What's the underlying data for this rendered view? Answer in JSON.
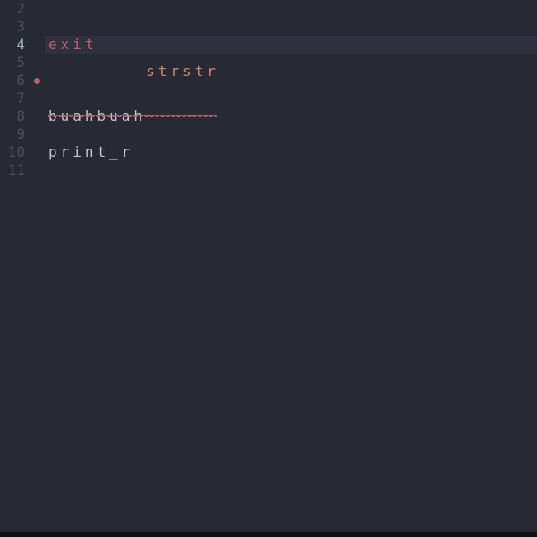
{
  "editor": {
    "current_line": 4,
    "lines": [
      {
        "number": 2,
        "text": "",
        "token": null,
        "marker": null
      },
      {
        "number": 3,
        "text": "",
        "token": null,
        "marker": null
      },
      {
        "number": 4,
        "text": "exit",
        "token": "exit",
        "marker": null
      },
      {
        "number": 5,
        "text": "",
        "token": null,
        "marker": null
      },
      {
        "number": 6,
        "text": "strstr",
        "token": "strstr",
        "marker": "error-dot",
        "underline": "error"
      },
      {
        "number": 7,
        "text": "",
        "token": null,
        "marker": null
      },
      {
        "number": 8,
        "text": "buahbuah",
        "token": "buah",
        "marker": null
      },
      {
        "number": 9,
        "text": "",
        "token": null,
        "marker": null
      },
      {
        "number": 10,
        "text": "print_r",
        "token": "print",
        "marker": null
      },
      {
        "number": 11,
        "text": "",
        "token": null,
        "marker": null
      }
    ]
  }
}
